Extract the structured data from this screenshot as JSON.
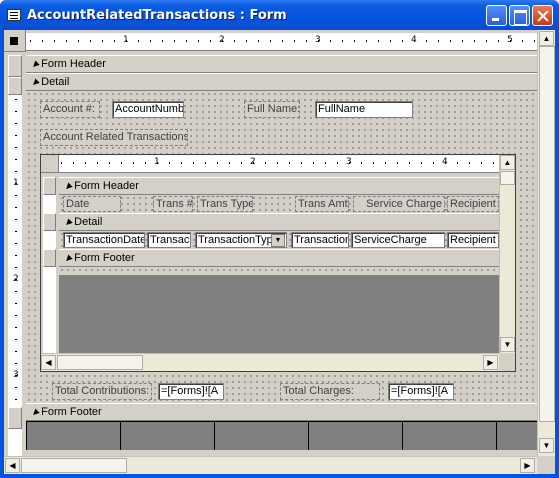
{
  "window": {
    "title": "AccountRelatedTransactions : Form"
  },
  "outer": {
    "ruler_numbers": [
      "1",
      "2",
      "3",
      "4",
      "5"
    ],
    "vruler_numbers": [
      "1",
      "2",
      "3"
    ],
    "sections": {
      "form_header": "Form Header",
      "detail": "Detail",
      "form_footer": "Form Footer"
    },
    "detail": {
      "account_label": "Account #:",
      "account_value": "AccountNumbe",
      "fullname_label": "Full Name:",
      "fullname_value": "FullName",
      "subform_label": "Account Related Transactions"
    },
    "footer_controls": {
      "contrib_label": "Total Contributions:",
      "contrib_value": "=[Forms]![A",
      "charges_label": "Total Charges:",
      "charges_value": "=[Forms]![A"
    }
  },
  "subform": {
    "ruler_numbers": [
      "1",
      "2",
      "3",
      "4"
    ],
    "sections": {
      "form_header": "Form Header",
      "detail": "Detail",
      "form_footer": "Form Footer"
    },
    "header_labels": [
      "Date",
      "Trans #",
      "Trans Type",
      "Trans Amt",
      "Service Charge",
      "Recipient"
    ],
    "detail_fields": [
      "TransactionDate",
      "Transac",
      "TransactionTyp",
      "Transaction",
      "ServiceCharge",
      "Recipient"
    ]
  }
}
